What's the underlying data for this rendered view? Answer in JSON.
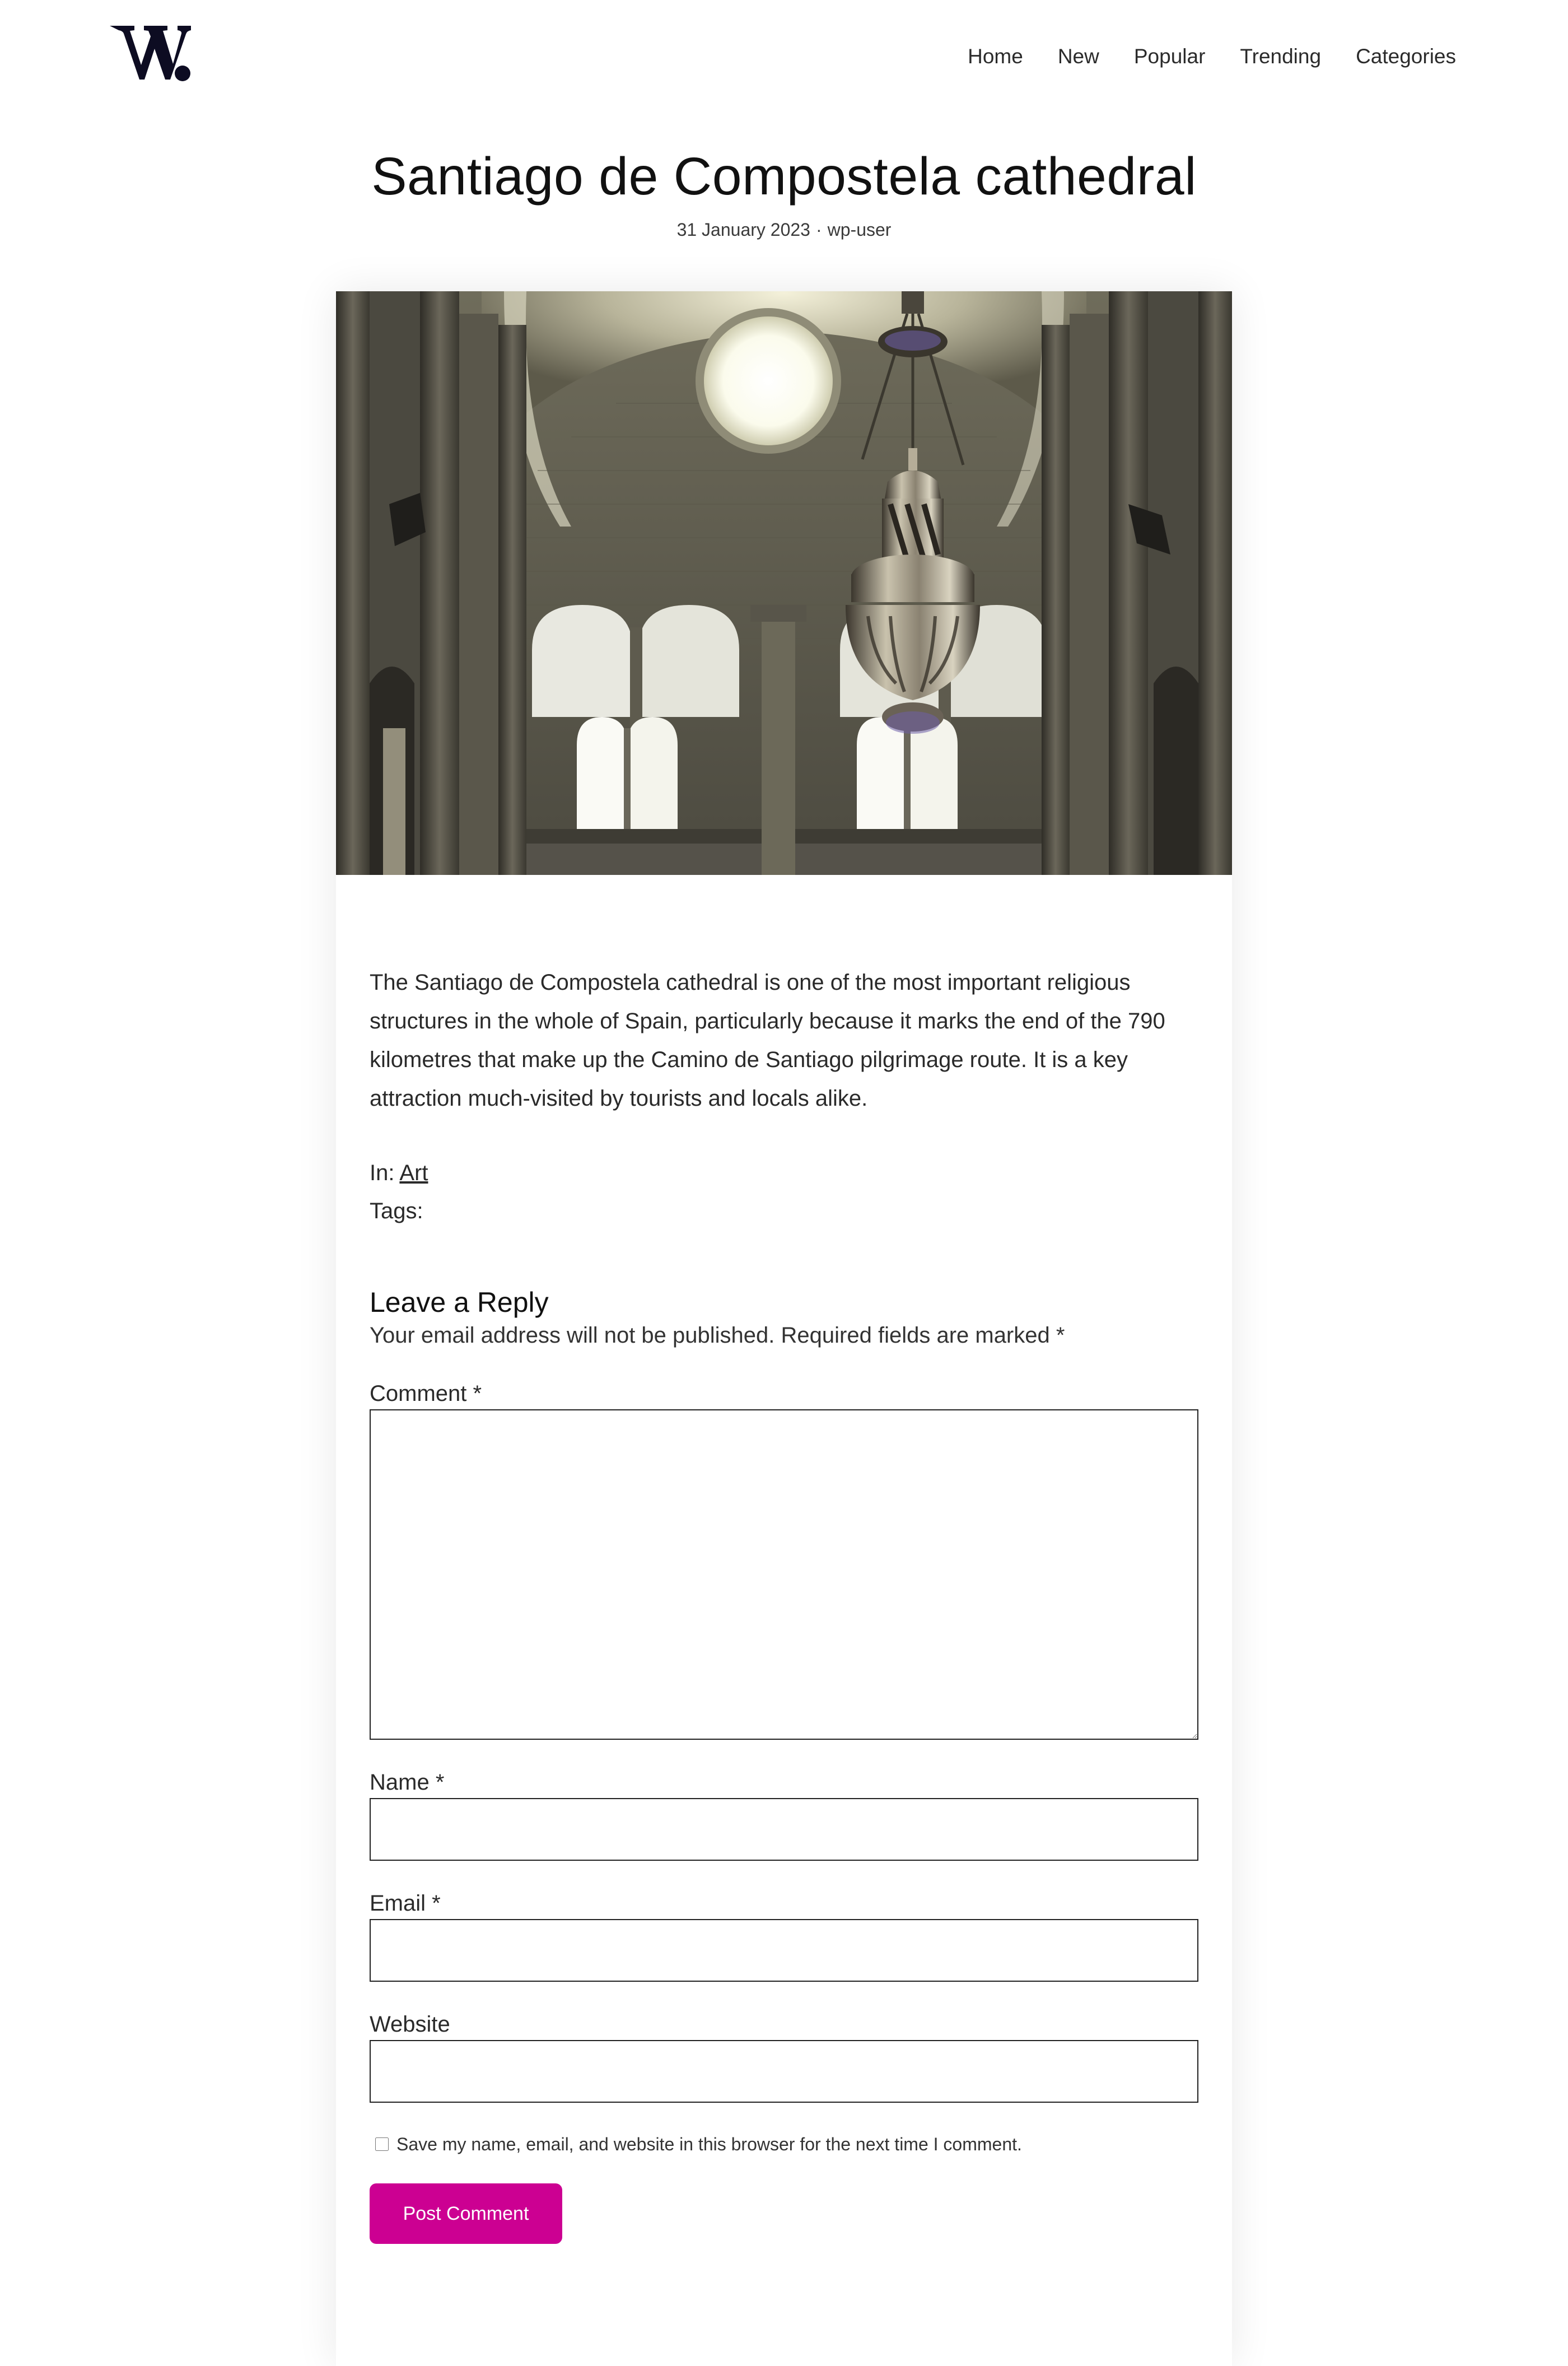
{
  "header": {
    "logo_alt": "W.",
    "nav": [
      {
        "label": "Home"
      },
      {
        "label": "New"
      },
      {
        "label": "Popular"
      },
      {
        "label": "Trending"
      },
      {
        "label": "Categories"
      }
    ]
  },
  "post": {
    "title": "Santiago de Compostela cathedral",
    "date": "31 January 2023",
    "separator": "·",
    "author": "wp-user",
    "image_alt": "Botafumeiro censer hanging in the nave of Santiago de Compostela cathedral",
    "excerpt": "The Santiago de Compostela cathedral is one of the most important religious structures in the whole of Spain, particularly because it marks the end of the 790 kilometres that make up the Camino de Santiago pilgrimage route. It is a key attraction much-visited by tourists and locals alike.",
    "categories_prefix": "In: ",
    "category": "Art",
    "tags_prefix": "Tags:"
  },
  "reply": {
    "title": "Leave a Reply",
    "note": "Your email address will not be published. Required fields are marked *",
    "comment_label": "Comment *",
    "name_label": "Name *",
    "email_label": "Email *",
    "website_label": "Website",
    "comment_value": "",
    "name_value": "",
    "email_value": "",
    "website_value": "",
    "consent_label": "Save my name, email, and website in this browser for the next time I comment.",
    "consent_checked": false,
    "submit_label": "Post Comment"
  },
  "colors": {
    "accent": "#cc0092",
    "logo": "#0d0c22",
    "text": "#2a2a2a"
  }
}
